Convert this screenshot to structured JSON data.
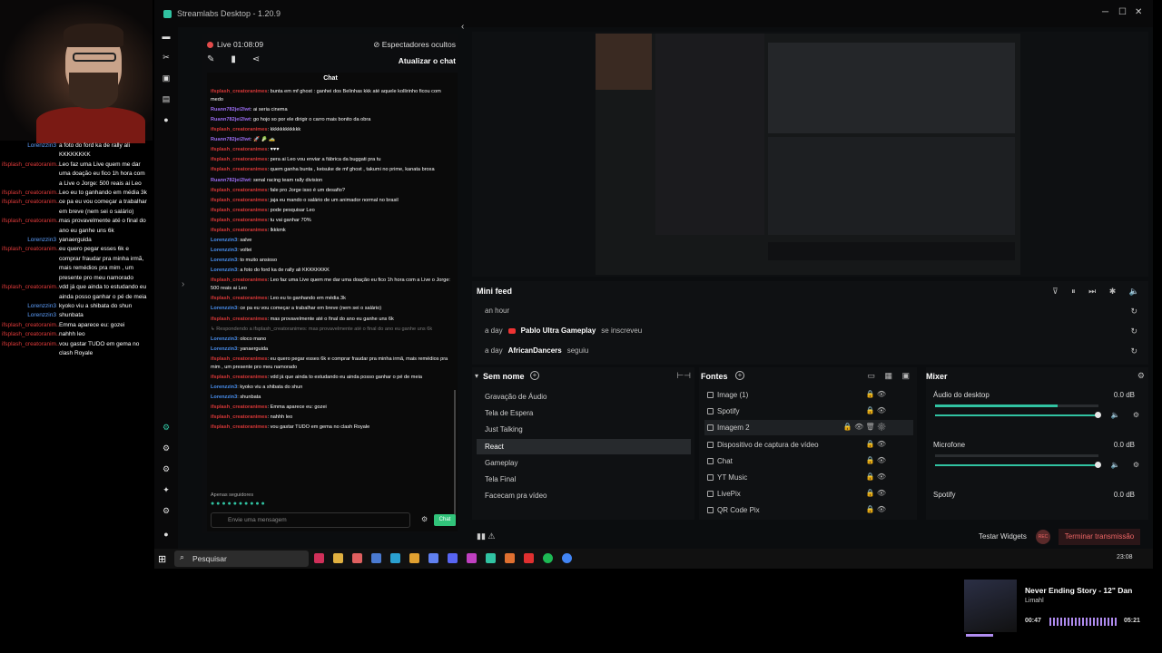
{
  "overlay_chat": [
    {
      "user": "Lorenzzin3",
      "color": "blue",
      "msg": "a foto do ford ka de rally ali KKKKKKKK"
    },
    {
      "user": "ifsplash_creatoranim..",
      "color": "red",
      "msg": "Leo faz uma Live quem me dar uma doação eu fico 1h hora com a Live o Jorge: 500 reais ai Leo"
    },
    {
      "user": "ifsplash_creatoranim..",
      "color": "red",
      "msg": "Leo eu to ganhando em média 3k"
    },
    {
      "user": "ifsplash_creatoranim..",
      "color": "red",
      "msg": "ce pa eu vou começar a trabalhar em breve (nem sei o salário)"
    },
    {
      "user": "ifsplash_creatoranim..",
      "color": "red",
      "msg": "mas provavelmente até o final do ano eu ganhe uns 6k"
    },
    {
      "user": "Lorenzzin3",
      "color": "blue",
      "msg": "yanaerguida"
    },
    {
      "user": "ifsplash_creatoranim..",
      "color": "red",
      "msg": "eu quero pegar esses 6k e comprar fraudar pra minha irmã, mais remédios pra mim , um presente pro meu namorado"
    },
    {
      "user": "ifsplash_creatoranim..",
      "color": "red",
      "msg": "vdd já que ainda to estudando eu ainda posso ganhar o pé de meia"
    },
    {
      "user": "Lorenzzin3",
      "color": "blue",
      "msg": "kyoko viu a shibata do shun"
    },
    {
      "user": "Lorenzzin3",
      "color": "blue",
      "msg": "shunbata"
    },
    {
      "user": "ifsplash_creatoranim..",
      "color": "red",
      "msg": "Emma aparece eu: gozei"
    },
    {
      "user": "ifsplash_creatoranim..",
      "color": "red",
      "msg": "nahhh leo"
    },
    {
      "user": "ifsplash_creatoranim..",
      "color": "red",
      "msg": "vou gastar TUDO em gema no clash Royale"
    }
  ],
  "app": {
    "title": "Streamlabs Desktop - 1.20.9"
  },
  "chatpanel": {
    "live_time": "Live 01:08:09",
    "viewers": "Espectadores ocultos",
    "refresh": "Atualizar o chat",
    "chat_header": "Chat",
    "supporters": "Apenas seguidores",
    "input_placeholder": "Envie uma mensagem",
    "send": "Chat",
    "messages": [
      {
        "user": "ifsplash_creatoranimes",
        "color": "red",
        "msg": "bunta em mf ghost : ganhei dos Belinhas kkk até aquele kollirinho ficou com medo"
      },
      {
        "user": "Ruann782jei2lwt",
        "color": "purple",
        "msg": "ai seria cinema"
      },
      {
        "user": "Ruann782jei2lwt",
        "color": "purple",
        "msg": "go hojo so por ele dirigir o carro mais bonito da obra"
      },
      {
        "user": "ifsplash_creatoranimes",
        "color": "red",
        "msg": "kkkkkkkkkkkk"
      },
      {
        "user": "Ruann782jei2lwt",
        "color": "purple",
        "msg": "🚀 🥬 🚕"
      },
      {
        "user": "ifsplash_creatoranimes",
        "color": "red",
        "msg": "♥♥♥"
      },
      {
        "user": "ifsplash_creatoranimes",
        "color": "red",
        "msg": "pera ai Leo vou enviar a fábrica da buggati pra tu"
      },
      {
        "user": "ifsplash_creatoranimes",
        "color": "red",
        "msg": "quem ganha bunta , keisuke de mf ghost , takumi no prime, kanata broxa"
      },
      {
        "user": "Ruann782jei2lwt",
        "color": "purple",
        "msg": "senal racing team rally division"
      },
      {
        "user": "ifsplash_creatoranimes",
        "color": "red",
        "msg": "fale pro Jorge isso é um desafio?"
      },
      {
        "user": "ifsplash_creatoranimes",
        "color": "red",
        "msg": "jaja eu mando o salário de um animador normal no brasil"
      },
      {
        "user": "ifsplash_creatoranimes",
        "color": "red",
        "msg": "pode pesquisar Leo"
      },
      {
        "user": "ifsplash_creatoranimes",
        "color": "red",
        "msg": "tu vai ganhar 70%"
      },
      {
        "user": "ifsplash_creatoranimes",
        "color": "red",
        "msg": "lkkkmk"
      },
      {
        "user": "Lorenzzin3",
        "color": "blue",
        "msg": "salve"
      },
      {
        "user": "Lorenzzin3",
        "color": "blue",
        "msg": "voltei"
      },
      {
        "user": "Lorenzzin3",
        "color": "blue",
        "msg": "to muito ansioso"
      },
      {
        "user": "Lorenzzin3",
        "color": "blue",
        "msg": "a foto do ford ka de rally ali KKKKKKKK"
      },
      {
        "user": "ifsplash_creatoranimes",
        "color": "red",
        "msg": "Leo faz uma Live quem me dar uma doação eu fico 1h hora com a Live o Jorge: 500 reais ai Leo"
      },
      {
        "user": "ifsplash_creatoranimes",
        "color": "red",
        "msg": "Leo eu to ganhando em média 3k"
      },
      {
        "user": "Lorenzzin3",
        "color": "blue",
        "msg": "ce pa eu vou começar a trabalhar em breve (nem sei o salário)"
      },
      {
        "user": "ifsplash_creatoranimes",
        "color": "red",
        "msg": "mas provavelmente até o final do ano eu ganhe uns 6k"
      },
      {
        "user": "",
        "color": "",
        "msg": "↳ Respondendo a ifsplash_creatoranimes: mas provavelmente até o final do ano eu ganhe uns 6k",
        "reply": true
      },
      {
        "user": "Lorenzzin3",
        "color": "blue",
        "msg": "oloco mano"
      },
      {
        "user": "Lorenzzin3",
        "color": "blue",
        "msg": "yanaerguida"
      },
      {
        "user": "ifsplash_creatoranimes",
        "color": "red",
        "msg": "eu quero pegar esses 6k e comprar fraudar pra minha irmã, mais remédios pra mim , um presente pro meu namorado"
      },
      {
        "user": "ifsplash_creatoranimes",
        "color": "red",
        "msg": "vdd já que ainda to estudando eu ainda posso ganhar o pé de meia"
      },
      {
        "user": "Lorenzzin3",
        "color": "blue",
        "msg": "kyoko viu a shibata do shun"
      },
      {
        "user": "Lorenzzin3",
        "color": "blue",
        "msg": "shunbata"
      },
      {
        "user": "ifsplash_creatoranimes",
        "color": "red",
        "msg": "Emma aparece eu: gozei"
      },
      {
        "user": "ifsplash_creatoranimes",
        "color": "red",
        "msg": "nahhh leo"
      },
      {
        "user": "ifsplash_creatoranimes",
        "color": "red",
        "msg": "vou gastar TUDO em gema no clash Royale"
      }
    ]
  },
  "minifeed": {
    "title": "Mini feed",
    "rows": [
      {
        "time": "an hour",
        "name": "",
        "action": ""
      },
      {
        "time": "a day",
        "name": "Pablo Ultra Gameplay",
        "action": "se inscreveu",
        "yt": true
      },
      {
        "time": "a day",
        "name": "AfricanDancers",
        "action": "seguiu"
      }
    ]
  },
  "scenes": {
    "title": "Sem nome",
    "items": [
      "Gravação de Áudio",
      "Tela de Espera",
      "Just Talking",
      "React",
      "Gameplay",
      "Tela Final",
      "Facecam pra vídeo"
    ],
    "active": 3
  },
  "sources": {
    "title": "Fontes",
    "items": [
      "Image (1)",
      "Spotify",
      "Imagem 2",
      "Dispositivo de captura de vídeo",
      "Chat",
      "YT Music",
      "LivePix",
      "QR Code Pix"
    ],
    "active": 2
  },
  "mixer": {
    "title": "Mixer",
    "channels": [
      {
        "name": "Áudio do desktop",
        "db": "0.0 dB",
        "level": 0.75
      },
      {
        "name": "Microfone",
        "db": "0.0 dB",
        "level": 0.0
      },
      {
        "name": "Spotify",
        "db": "0.0 dB",
        "level": 0.0
      }
    ]
  },
  "bottombar": {
    "test_widgets": "Testar Widgets",
    "rec": "REC",
    "end_stream": "Terminar transmissão"
  },
  "taskbar": {
    "search": "Pesquisar",
    "time": "23:08"
  },
  "now_playing": {
    "title": "Never Ending Story - 12\" Dan",
    "artist": "Limahl",
    "elapsed": "00:47",
    "total": "05:21"
  },
  "colors": {
    "accent": "#31c3a2",
    "live": "#e34b4b",
    "end": "#e66666"
  }
}
